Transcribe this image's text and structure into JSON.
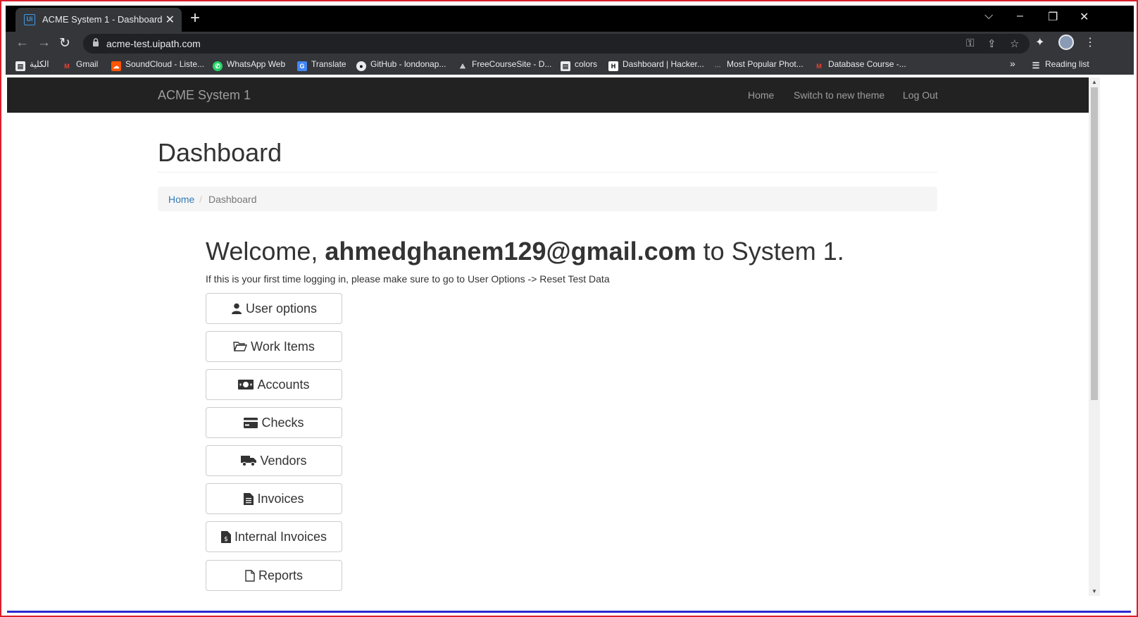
{
  "browser": {
    "tab_title": "ACME System 1 - Dashboard",
    "url": "acme-test.uipath.com",
    "bookmarks": [
      {
        "label": "الكلية",
        "icon": "doc-icon"
      },
      {
        "label": "Gmail",
        "icon": "gmail-icon"
      },
      {
        "label": "SoundCloud - Liste...",
        "icon": "soundcloud-icon"
      },
      {
        "label": "WhatsApp Web",
        "icon": "whatsapp-icon"
      },
      {
        "label": "Translate",
        "icon": "translate-icon"
      },
      {
        "label": "GitHub - londonap...",
        "icon": "github-icon"
      },
      {
        "label": "FreeCourseSite - D...",
        "icon": "freecourse-icon"
      },
      {
        "label": "colors",
        "icon": "doc-icon"
      },
      {
        "label": "Dashboard | Hacker...",
        "icon": "hackerrank-icon"
      },
      {
        "label": "Most Popular Phot...",
        "icon": "photo-icon"
      },
      {
        "label": "Database Course -...",
        "icon": "gmail-icon"
      }
    ],
    "more_bookmarks": "»",
    "reading_list": "Reading list"
  },
  "navbar": {
    "brand": "ACME System 1",
    "links": [
      "Home",
      "Switch to new theme",
      "Log Out"
    ]
  },
  "page": {
    "title": "Dashboard",
    "breadcrumb": {
      "home": "Home",
      "separator": "/",
      "current": "Dashboard"
    },
    "welcome_prefix": "Welcome, ",
    "welcome_email": "ahmedghanem129@gmail.com",
    "welcome_suffix": " to System 1.",
    "hint": "If this is your first time logging in, please make sure to go to User Options -> Reset Test Data"
  },
  "menu_buttons": [
    {
      "label": "User options",
      "icon": "user-icon"
    },
    {
      "label": "Work Items",
      "icon": "folder-open-icon"
    },
    {
      "label": "Accounts",
      "icon": "money-icon"
    },
    {
      "label": "Checks",
      "icon": "credit-card-icon"
    },
    {
      "label": "Vendors",
      "icon": "truck-icon"
    },
    {
      "label": "Invoices",
      "icon": "file-text-icon"
    },
    {
      "label": "Internal Invoices",
      "icon": "file-invoice-icon"
    },
    {
      "label": "Reports",
      "icon": "file-icon"
    }
  ],
  "colors": {
    "navbar_bg": "#222222",
    "link": "#337ab7",
    "chrome_bg": "#35363a"
  }
}
